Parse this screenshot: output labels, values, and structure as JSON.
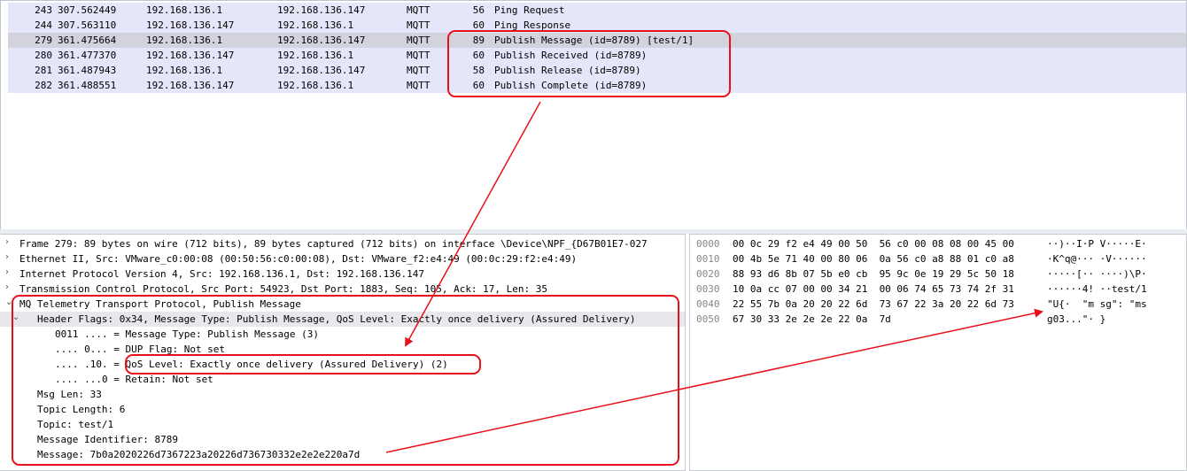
{
  "packets": [
    {
      "no": "243",
      "time": "307.562449",
      "src": "192.168.136.1",
      "dst": "192.168.136.147",
      "proto": "MQTT",
      "len": "56",
      "info": "Ping Request"
    },
    {
      "no": "244",
      "time": "307.563110",
      "src": "192.168.136.147",
      "dst": "192.168.136.1",
      "proto": "MQTT",
      "len": "60",
      "info": "Ping Response"
    },
    {
      "no": "279",
      "time": "361.475664",
      "src": "192.168.136.1",
      "dst": "192.168.136.147",
      "proto": "MQTT",
      "len": "89",
      "info": "Publish Message (id=8789) [test/1]"
    },
    {
      "no": "280",
      "time": "361.477370",
      "src": "192.168.136.147",
      "dst": "192.168.136.1",
      "proto": "MQTT",
      "len": "60",
      "info": "Publish Received (id=8789)"
    },
    {
      "no": "281",
      "time": "361.487943",
      "src": "192.168.136.1",
      "dst": "192.168.136.147",
      "proto": "MQTT",
      "len": "58",
      "info": "Publish Release (id=8789)"
    },
    {
      "no": "282",
      "time": "361.488551",
      "src": "192.168.136.147",
      "dst": "192.168.136.1",
      "proto": "MQTT",
      "len": "60",
      "info": "Publish Complete (id=8789)"
    }
  ],
  "details": [
    {
      "tw": "›",
      "text": "Frame 279: 89 bytes on wire (712 bits), 89 bytes captured (712 bits) on interface \\Device\\NPF_{D67B01E7-027"
    },
    {
      "tw": "›",
      "text": "Ethernet II, Src: VMware_c0:00:08 (00:50:56:c0:00:08), Dst: VMware_f2:e4:49 (00:0c:29:f2:e4:49)"
    },
    {
      "tw": "›",
      "text": "Internet Protocol Version 4, Src: 192.168.136.1, Dst: 192.168.136.147"
    },
    {
      "tw": "›",
      "text": "Transmission Control Protocol, Src Port: 54923, Dst Port: 1883, Seq: 105, Ack: 17, Len: 35"
    },
    {
      "tw": "⌄",
      "text": "MQ Telemetry Transport Protocol, Publish Message"
    },
    {
      "tw": "⌄",
      "text": "Header Flags: 0x34, Message Type: Publish Message, QoS Level: Exactly once delivery (Assured Delivery)"
    },
    {
      "tw": "",
      "text": "0011 .... = Message Type: Publish Message (3)"
    },
    {
      "tw": "",
      "text": ".... 0... = DUP Flag: Not set"
    },
    {
      "tw": "",
      "text": ".... .10. = QoS Level: Exactly once delivery (Assured Delivery) (2)"
    },
    {
      "tw": "",
      "text": ".... ...0 = Retain: Not set"
    },
    {
      "tw": "",
      "text": "Msg Len: 33"
    },
    {
      "tw": "",
      "text": "Topic Length: 6"
    },
    {
      "tw": "",
      "text": "Topic: test/1"
    },
    {
      "tw": "",
      "text": "Message Identifier: 8789"
    },
    {
      "tw": "",
      "text": "Message: 7b0a2020226d7367223a20226d736730332e2e2e220a7d"
    }
  ],
  "hexdump": [
    {
      "offset": "0000",
      "hex": "00 0c 29 f2 e4 49 00 50  56 c0 00 08 08 00 45 00",
      "ascii": "··)··I·P V·····E·"
    },
    {
      "offset": "0010",
      "hex": "00 4b 5e 71 40 00 80 06  0a 56 c0 a8 88 01 c0 a8",
      "ascii": "·K^q@··· ·V······"
    },
    {
      "offset": "0020",
      "hex": "88 93 d6 8b 07 5b e0 cb  95 9c 0e 19 29 5c 50 18",
      "ascii": "·····[·· ····)\\P·"
    },
    {
      "offset": "0030",
      "hex": "10 0a cc 07 00 00 34 21  00 06 74 65 73 74 2f 31",
      "ascii": "······4! ··test/1"
    },
    {
      "offset": "0040",
      "hex": "22 55 7b 0a 20 20 22 6d  73 67 22 3a 20 22 6d 73",
      "ascii": "\"U{·  \"m sg\": \"ms"
    },
    {
      "offset": "0050",
      "hex": "67 30 33 2e 2e 2e 22 0a  7d",
      "ascii": "g03...\"· }"
    }
  ],
  "colors": {
    "row_bg": "#e6e6fa",
    "row_selected_bg": "#d3d3dd",
    "row_hover_bg": "#e5f3ff",
    "annotation": "#e8101a"
  }
}
